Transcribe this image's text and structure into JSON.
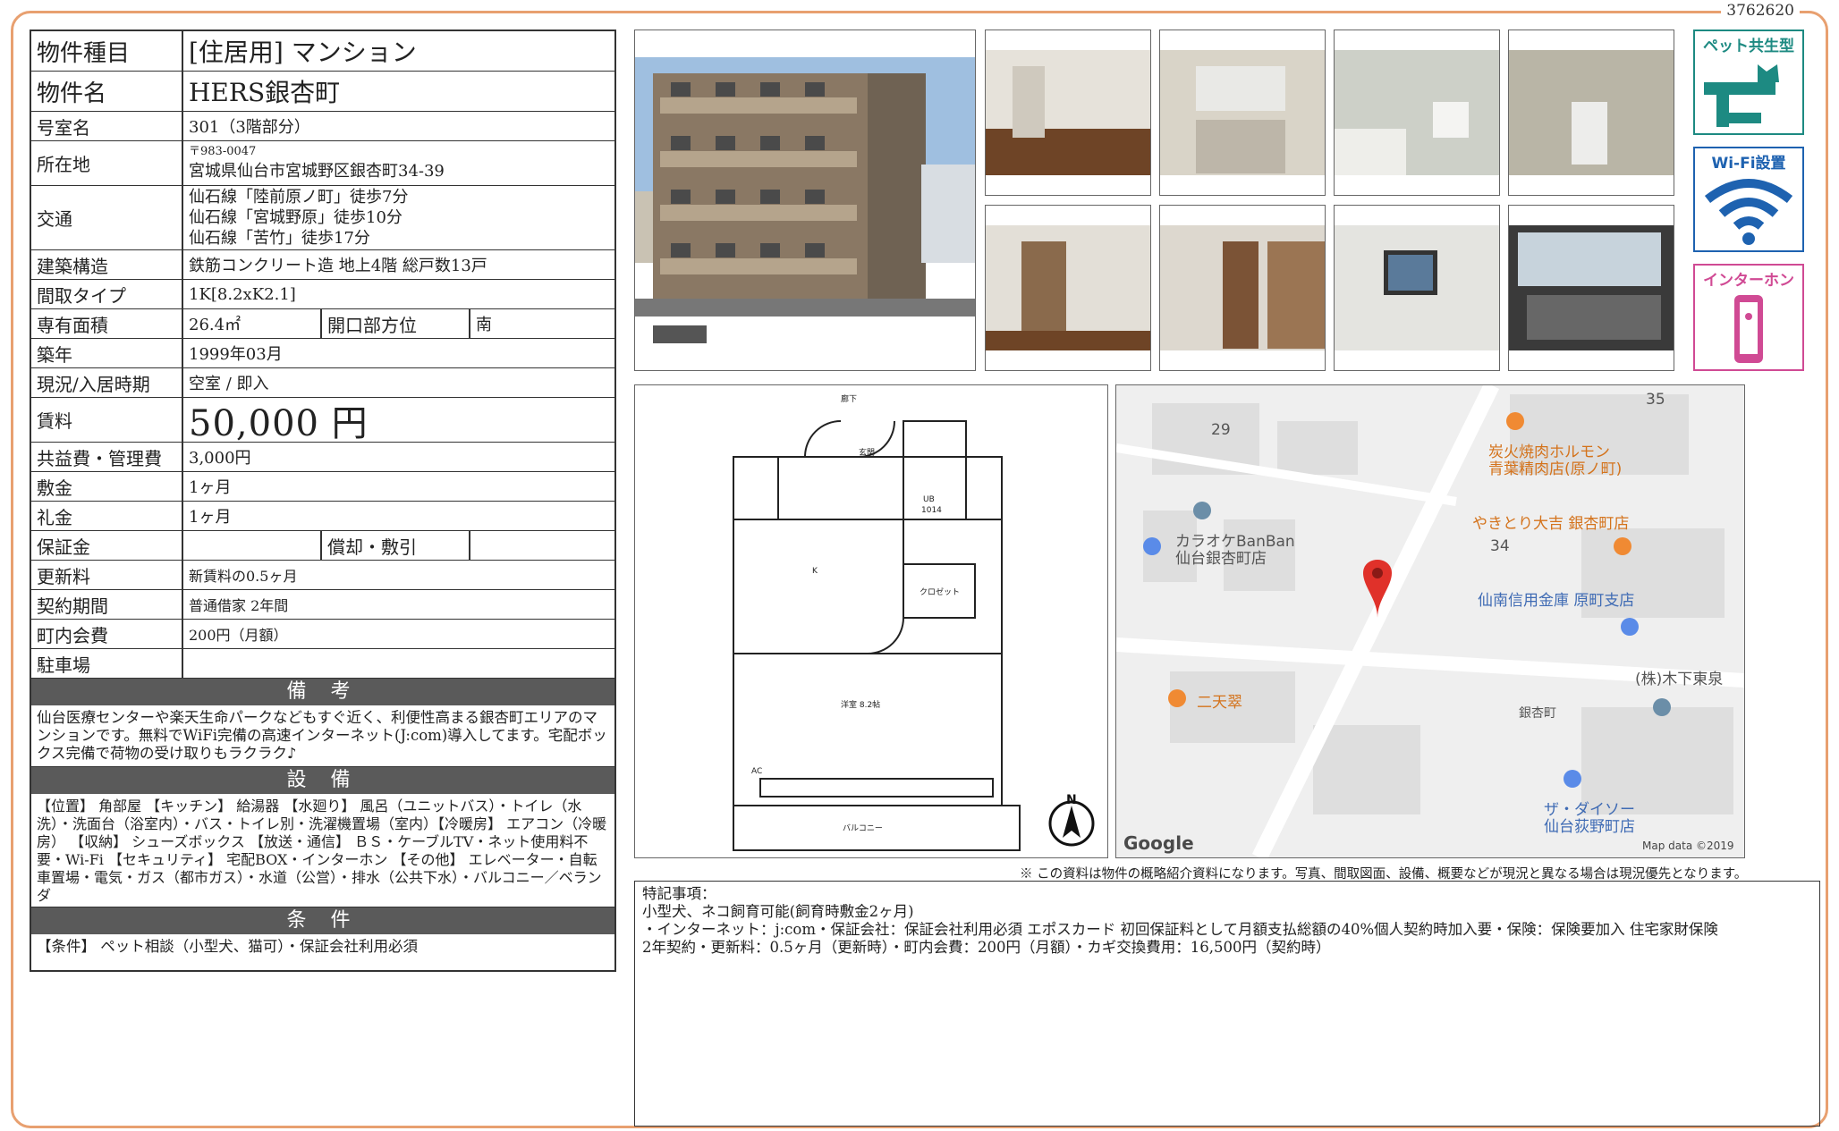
{
  "doc_id": "3762620",
  "spec": {
    "type_label": "物件種目",
    "type_value": "[住居用] マンション",
    "name_label": "物件名",
    "name_value": "HERS銀杏町",
    "room_label": "号室名",
    "room_value": "301（3階部分）",
    "address_label": "所在地",
    "zip": "〒983-0047",
    "address_value": "宮城県仙台市宮城野区銀杏町34-39",
    "access_label": "交通",
    "access_1": "仙石線「陸前原ノ町」徒歩7分",
    "access_2": "仙石線「宮城野原」徒歩10分",
    "access_3": "仙石線「苦竹」徒歩17分",
    "structure_label": "建築構造",
    "structure_value": "鉄筋コンクリート造 地上4階 総戸数13戸",
    "layout_label": "間取タイプ",
    "layout_value": "1K[8.2xK2.1]",
    "area_label": "専有面積",
    "area_value": "26.4㎡",
    "direction_label": "開口部方位",
    "direction_value": "南",
    "built_label": "築年",
    "built_value": "1999年03月",
    "status_label": "現況/入居時期",
    "status_value": "空室 / 即入",
    "rent_label": "賃料",
    "rent_value": "50,000 円",
    "fee_label": "共益費・管理費",
    "fee_value": "3,000円",
    "deposit_label": "敷金",
    "deposit_value": "1ヶ月",
    "keymoney_label": "礼金",
    "keymoney_value": "1ヶ月",
    "guarantee_label": "保証金",
    "guarantee_value": "",
    "amort_label": "償却・敷引",
    "amort_value": "",
    "renewal_label": "更新料",
    "renewal_value": "新賃料の0.5ヶ月",
    "contract_label": "契約期間",
    "contract_value": "普通借家 2年間",
    "community_label": "町内会費",
    "community_value": "200円（月額）",
    "parking_label": "駐車場",
    "parking_value": ""
  },
  "remarks": {
    "title": "備 考",
    "text": "仙台医療センターや楽天生命パークなどもすぐ近く、利便性高まる銀杏町エリアのマンションです。無料でWiFi完備の高速インターネット(J:com)導入してます。宅配ボックス完備で荷物の受け取りもラクラク♪"
  },
  "facilities": {
    "title": "設 備",
    "text": "【位置】 角部屋 【キッチン】 給湯器 【水廻り】 風呂（ユニットバス）・トイレ（水洗）・洗面台（浴室内）・バス・トイレ別・洗濯機置場（室内）【冷暖房】 エアコン（冷暖房） 【収納】 シューズボックス 【放送・通信】 ＢＳ・ケーブルTV・ネット使用料不要・Wi-Fi 【セキュリティ】 宅配BOX・インターホン 【その他】 エレベーター・自転車置場・電気・ガス（都市ガス）・水道（公営）・排水（公共下水）・バルコニー／ベランダ"
  },
  "conditions": {
    "title": "条 件",
    "text": "【条件】 ペット相談（小型犬、猫可）・保証会社利用必須"
  },
  "badges": {
    "pet": "ペット共生型",
    "wifi": "Wi-Fi設置",
    "intercom": "インターホン"
  },
  "floorplan": {
    "hall": "廊下",
    "shoebox": "玄関",
    "ub": "UB",
    "ub_size": "1014",
    "kitchen": "K",
    "closet": "クロゼット",
    "room": "洋室 8.2帖",
    "ac": "AC",
    "balcony": "バルコニー",
    "north": "N"
  },
  "map": {
    "labels": {
      "n35": "35",
      "n29": "29",
      "n34": "34",
      "yakiniku_1": "炭火焼肉ホルモン",
      "yakiniku_2": "青葉精肉店(原ノ町)",
      "yakitori": "やきとり大吉 銀杏町店",
      "karaoke_1": "カラオケBanBan",
      "karaoke_2": "仙台銀杏町店",
      "bank": "仙南信用金庫 原町支店",
      "nitensui": "二天翠",
      "kinoshita": "(株)木下東泉",
      "ginkgo": "銀杏町",
      "daiso_1": "ザ・ダイソー",
      "daiso_2": "仙台荻野町店",
      "google": "Google",
      "mapdata": "Map data ©2019"
    }
  },
  "disclaimer": "※ この資料は物件の概略紹介資料になります。写真、間取図面、設備、概要などが現況と異なる場合は現況優先となります。",
  "notes": {
    "line1": "特記事項：",
    "line2": "小型犬、ネコ飼育可能(飼育時敷金2ヶ月)",
    "line3": "・インターネット：j:com・保証会社：保証会社利用必須 エポスカード 初回保証料として月額支払総額の40%個人契約時加入要・保険：保険要加入 住宅家財保険",
    "line4": "2年契約・更新料：0.5ヶ月（更新時）・町内会費：200円（月額）・カギ交換費用：16,500円（契約時）"
  }
}
